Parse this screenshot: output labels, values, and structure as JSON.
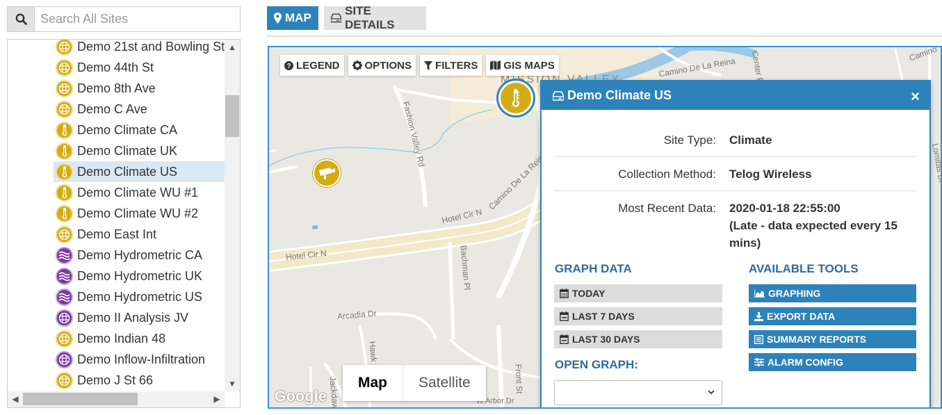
{
  "search": {
    "placeholder": "Search All Sites"
  },
  "sites": [
    {
      "label": "Demo 21st and Bowling St",
      "icon": "grid-gauge-icon",
      "color": "gold"
    },
    {
      "label": "Demo 44th St",
      "icon": "grid-gauge-icon",
      "color": "gold"
    },
    {
      "label": "Demo 8th Ave",
      "icon": "grid-gauge-icon",
      "color": "gold"
    },
    {
      "label": "Demo C Ave",
      "icon": "grid-gauge-icon",
      "color": "gold"
    },
    {
      "label": "Demo Climate CA",
      "icon": "thermometer-icon",
      "color": "gold"
    },
    {
      "label": "Demo Climate UK",
      "icon": "thermometer-icon",
      "color": "gold"
    },
    {
      "label": "Demo Climate US",
      "icon": "thermometer-icon",
      "color": "gold",
      "selected": true
    },
    {
      "label": "Demo Climate WU #1",
      "icon": "thermometer-icon",
      "color": "gold"
    },
    {
      "label": "Demo Climate WU #2",
      "icon": "thermometer-icon",
      "color": "gold"
    },
    {
      "label": "Demo East Int",
      "icon": "grid-gauge-icon",
      "color": "gold"
    },
    {
      "label": "Demo Hydrometric CA",
      "icon": "water-wave-icon",
      "color": "purple"
    },
    {
      "label": "Demo Hydrometric UK",
      "icon": "water-wave-icon",
      "color": "purple"
    },
    {
      "label": "Demo Hydrometric US",
      "icon": "water-wave-icon",
      "color": "purple"
    },
    {
      "label": "Demo II Analysis JV",
      "icon": "grid-gauge-icon",
      "color": "purple"
    },
    {
      "label": "Demo Indian 48",
      "icon": "grid-gauge-icon",
      "color": "gold"
    },
    {
      "label": "Demo Inflow-Infiltration",
      "icon": "grid-gauge-icon",
      "color": "purple"
    },
    {
      "label": "Demo J St 66",
      "icon": "grid-gauge-icon",
      "color": "gold"
    }
  ],
  "tabs": {
    "map": "MAP",
    "site_details": "SITE DETAILS"
  },
  "map_toolbar": {
    "legend": "LEGEND",
    "options": "OPTIONS",
    "filters": "FILTERS",
    "gis_maps": "GIS MAPS"
  },
  "map_type": {
    "map": "Map",
    "satellite": "Satellite"
  },
  "map_labels": {
    "mission_valley": "MISSION VALLEY",
    "camino_reina_top": "Camino De La Reina",
    "camino_reina_mid": "Camino De La Reina",
    "fashion_valley": "Fashion Valley Rd",
    "hotel_cir_n_1": "Hotel Cir N",
    "hotel_cir_n_2": "Hotel Cir N",
    "bachman_pl": "Bachman Pl",
    "arcadia_dr": "Arcadia Dr",
    "hawk_st": "Hawk St",
    "front_st": "Front St",
    "arbor_dr": "W Arbor Dr",
    "center_rd": "Center Rd",
    "camino_right": "Camino",
    "lomitas": "Lomitas Dr",
    "jackdaw": "Jackdaw"
  },
  "google": "Google",
  "popup": {
    "title": "Demo Climate US",
    "close": "×",
    "rows": [
      {
        "key": "Site Type:",
        "value": "Climate"
      },
      {
        "key": "Collection Method:",
        "value": "Telog Wireless"
      },
      {
        "key": "Most Recent Data:",
        "value": "2020-01-18 22:55:00",
        "note": "(Late - data expected every 15 mins)"
      }
    ],
    "graph_data_title": "GRAPH DATA",
    "graph_buttons": [
      "TODAY",
      "LAST 7 DAYS",
      "LAST 30 DAYS"
    ],
    "tools_title": "AVAILABLE TOOLS",
    "tool_buttons": [
      "GRAPHING",
      "EXPORT DATA",
      "SUMMARY REPORTS",
      "ALARM CONFIG"
    ],
    "open_graph_title": "OPEN GRAPH:",
    "open_graph_value": ""
  },
  "colors": {
    "accent": "#2d83b9",
    "gold": "#d4ad16",
    "purple": "#7a3a9e",
    "selected_row": "#d7e9f5"
  }
}
